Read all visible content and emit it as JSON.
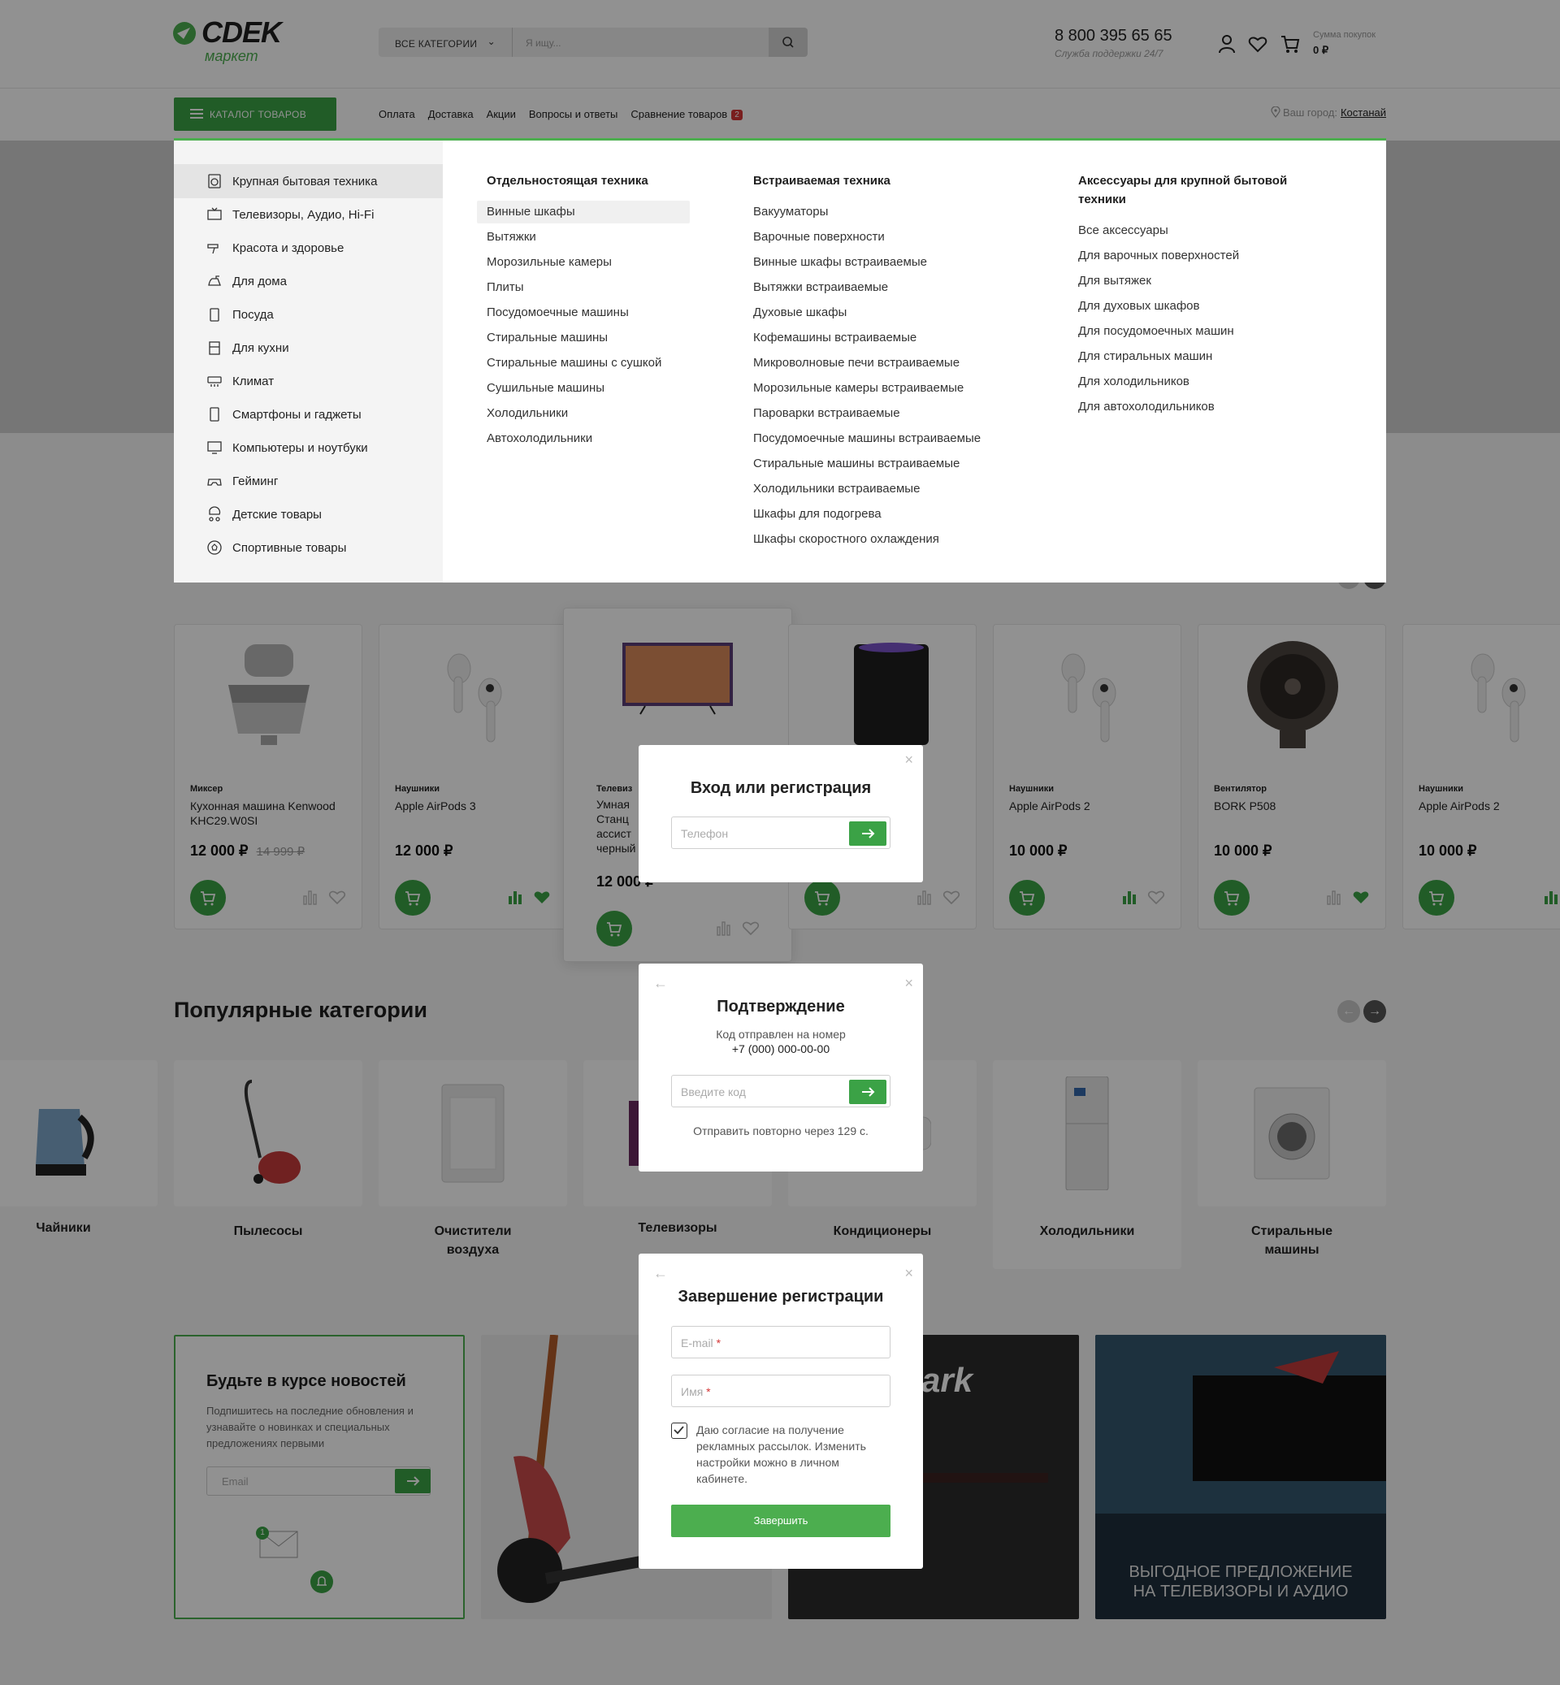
{
  "header": {
    "logo_text": "CDEK",
    "logo_sub": "маркет",
    "category_select": "ВСЕ КАТЕГОРИИ",
    "search_placeholder": "Я ищу...",
    "phone": "8 800 395 65 65",
    "support": "Служба поддержки 24/7",
    "sum_label": "Сумма покупок",
    "sum_value": "0 ₽"
  },
  "nav": {
    "catalog_button": "КАТАЛОГ ТОВАРОВ",
    "links": [
      "Оплата",
      "Доставка",
      "Акции",
      "Вопросы и ответы",
      "Сравнение товаров"
    ],
    "compare_count": "2",
    "city_label": "Ваш город:",
    "city": "Костанай"
  },
  "mega_menu": {
    "categories": [
      "Крупная бытовая техника",
      "Телевизоры, Аудио, Hi-Fi",
      "Красота и здоровье",
      "Для дома",
      "Посуда",
      "Для кухни",
      "Климат",
      "Смартфоны и гаджеты",
      "Компьютеры и ноутбуки",
      "Гейминг",
      "Детские товары",
      "Спортивные товары"
    ],
    "columns": [
      {
        "title": "Отдельностоящая техника",
        "links": [
          "Винные шкафы",
          "Вытяжки",
          "Морозильные камеры",
          "Плиты",
          "Посудомоечные машины",
          "Стиральные машины",
          "Стиральные машины с сушкой",
          "Сушильные машины",
          "Холодильники",
          "Автохолодильники"
        ]
      },
      {
        "title": "Встраиваемая техника",
        "links": [
          "Вакууматоры",
          "Варочные поверхности",
          "Винные шкафы встраиваемые",
          "Вытяжки встраиваемые",
          "Духовые шкафы",
          "Кофемашины встраиваемые",
          "Микроволновые печи встраиваемые",
          "Морозильные камеры встраиваемые",
          "Пароварки встраиваемые",
          "Посудомоечные машины встраиваемые",
          "Стиральные машины встраиваемые",
          "Холодильники встраиваемые",
          "Шкафы для подогрева",
          "Шкафы скоростного охлаждения"
        ]
      },
      {
        "title": "Аксессуары для крупной бытовой техники",
        "links": [
          "Все аксессуары",
          "Для варочных поверхностей",
          "Для вытяжек",
          "Для духовых шкафов",
          "Для посудомоечных машин",
          "Для стиральных машин",
          "Для холодильников",
          "Для автохолодильников"
        ]
      }
    ]
  },
  "products": [
    {
      "category": "Миксер",
      "title": "Кухонная машина Kenwood KHC29.W0SI",
      "price": "12 000 ₽",
      "old_price": "14 999 ₽",
      "favorite": false,
      "compared": false
    },
    {
      "category": "Наушники",
      "title": "Apple AirPods 3",
      "price": "12 000 ₽",
      "old_price": "",
      "favorite": true,
      "compared": true
    },
    {
      "category": "Телевиз",
      "title": "Умная Станц ассист черный",
      "price": "12 000 ₽",
      "old_price": "",
      "favorite": false,
      "compared": false
    },
    {
      "category": "",
      "title": "",
      "price": "",
      "old_price": "",
      "favorite": false,
      "compared": false
    },
    {
      "category": "Наушники",
      "title": "Apple AirPods 2",
      "price": "10 000 ₽",
      "old_price": "",
      "favorite": false,
      "compared": true
    },
    {
      "category": "Вентилятор",
      "title": "BORK P508",
      "price": "10 000 ₽",
      "old_price": "",
      "favorite": true,
      "compared": false
    },
    {
      "category": "Наушники",
      "title": "Apple AirPods 2",
      "price": "10 000 ₽",
      "old_price": "",
      "favorite": false,
      "compared": true
    }
  ],
  "popular": {
    "title": "Популярные категории",
    "items": [
      "Чайники",
      "Пылесосы",
      "Очистители воздуха",
      "Телевизоры",
      "Кондиционеры",
      "Холодильники",
      "Стиральные машины"
    ]
  },
  "newsletter": {
    "title": "Будьте в курсе новостей",
    "text": "Подпишитесь на последние обновления и узнавайте о новинках и специальных предложениях первыми",
    "email_placeholder": "Email",
    "badge": "1"
  },
  "promos": {
    "brand_text": "ark",
    "tv_text": "ВЫГОДНОЕ ПРЕДЛОЖЕНИЕ НА ТЕЛЕВИЗОРЫ И АУДИО"
  },
  "modal_login": {
    "title": "Вход или регистрация",
    "phone_placeholder": "Телефон"
  },
  "modal_confirm": {
    "title": "Подтверждение",
    "text": "Код отправлен на номер",
    "phone": "+7 (000) 000-00-00",
    "code_placeholder": "Введите код",
    "resend": "Отправить повторно через 129 с."
  },
  "modal_finish": {
    "title": "Завершение регистрации",
    "email_placeholder": "E-mail",
    "name_placeholder": "Имя",
    "required_mark": "*",
    "consent": "Даю согласие на получение рекламных рассылок. Изменить настройки можно в личном кабинете.",
    "consent_checked": true,
    "submit": "Завершить"
  },
  "colors": {
    "brand_green": "#3ba246",
    "accent_red": "#d53636"
  }
}
